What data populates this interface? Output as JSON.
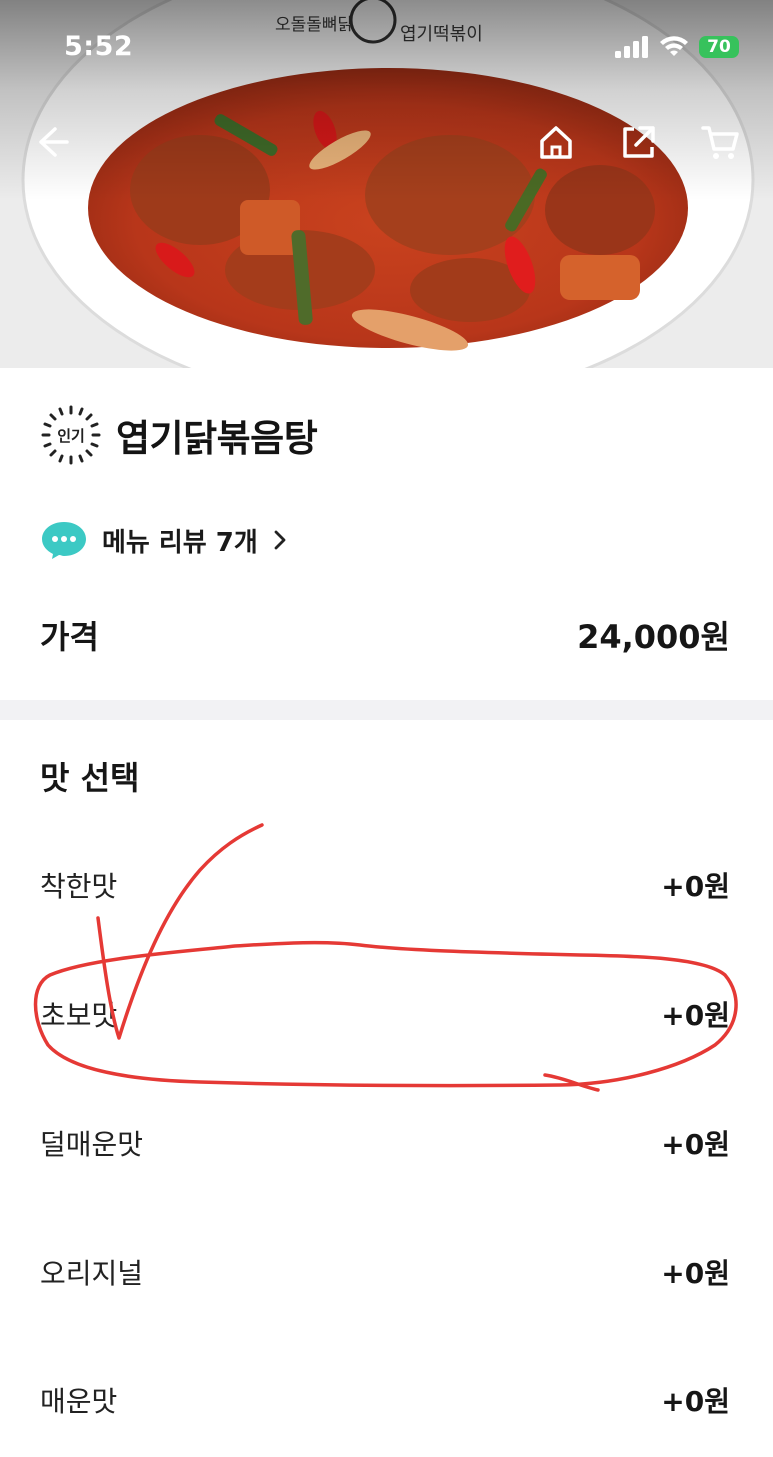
{
  "status_bar": {
    "time": "5:52",
    "battery": "70"
  },
  "hero": {
    "bowl_text_left": "오돌돌뼈닭",
    "bowl_text_right": "엽기떡볶이"
  },
  "nav": {
    "icons": [
      "back-arrow-icon",
      "home-icon",
      "share-icon",
      "cart-icon"
    ]
  },
  "menu": {
    "badge": "인기",
    "title": "엽기닭볶음탕",
    "review_link": "메뉴 리뷰 7개",
    "price_label": "가격",
    "price_value": "24,000원"
  },
  "options": {
    "title": "맛 선택",
    "items": [
      {
        "name": "착한맛",
        "price": "+0원"
      },
      {
        "name": "초보맛",
        "price": "+0원"
      },
      {
        "name": "덜매운맛",
        "price": "+0원"
      },
      {
        "name": "오리지널",
        "price": "+0원"
      },
      {
        "name": "매운맛",
        "price": "+0원"
      }
    ]
  },
  "colors": {
    "accent_review_icon": "#3cc9c4",
    "annotation_red": "#e53935",
    "divider": "#f2f2f4",
    "battery_green": "#37c25c"
  }
}
